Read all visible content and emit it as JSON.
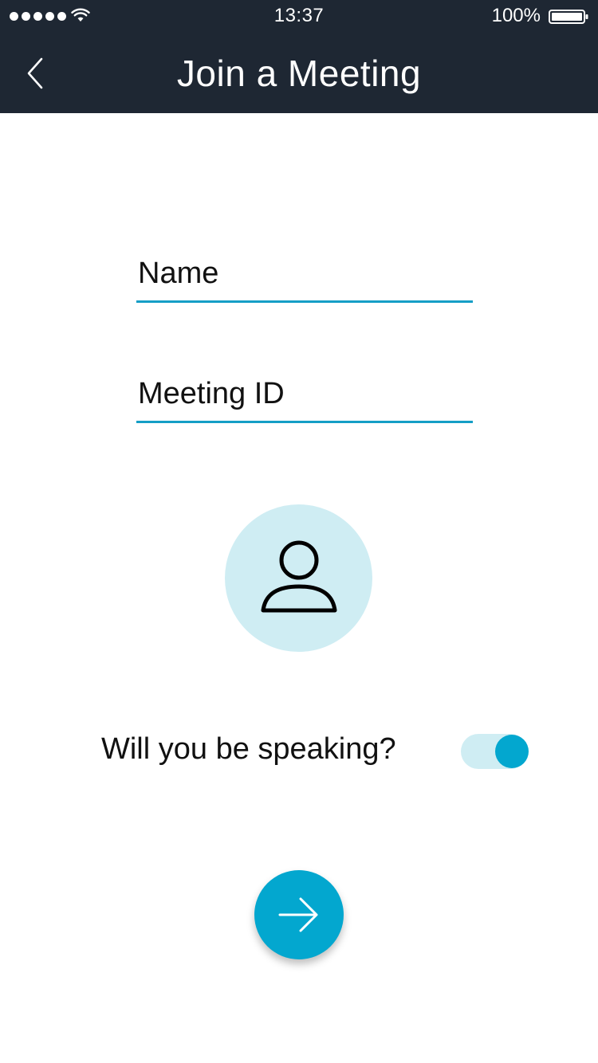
{
  "status_bar": {
    "time": "13:37",
    "battery_percent": "100%",
    "signal_bars": 5,
    "icons": [
      "signal-icon",
      "wifi-icon",
      "battery-icon"
    ]
  },
  "header": {
    "title": "Join a Meeting",
    "back_icon": "chevron-left-icon",
    "background_color": "#1e2733"
  },
  "form": {
    "name_placeholder": "Name",
    "name_value": "",
    "meeting_id_placeholder": "Meeting ID",
    "meeting_id_value": ""
  },
  "avatar": {
    "icon": "user-icon",
    "background_color": "#cfedf3"
  },
  "speaking": {
    "label": "Will you be speaking?",
    "enabled": true
  },
  "continue_button": {
    "icon": "arrow-right-icon",
    "color": "#03a7cf"
  },
  "colors": {
    "accent": "#03a7cf",
    "underline": "#159ec6",
    "light_accent": "#cfedf3"
  }
}
